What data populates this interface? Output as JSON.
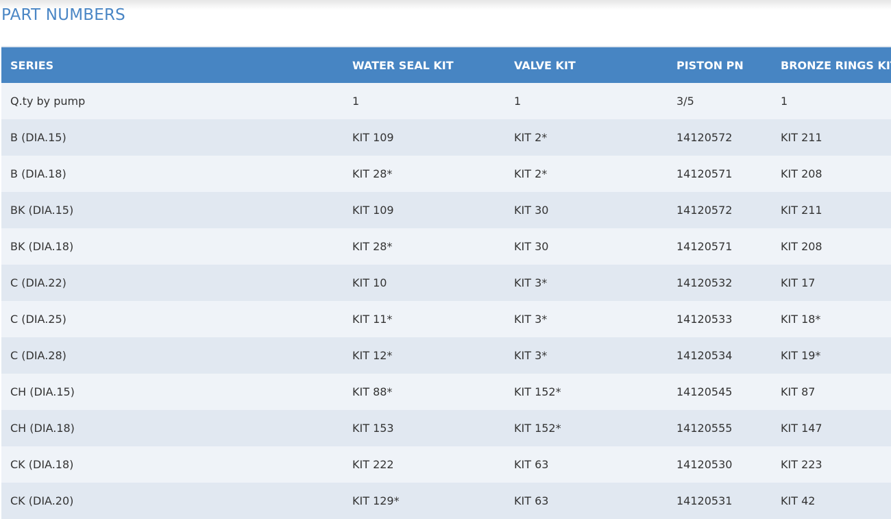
{
  "page": {
    "title": "PART NUMBERS"
  },
  "colors": {
    "title": "#4a86c5",
    "header_bg": "#4785c3",
    "row_odd": "#eff3f8",
    "row_even": "#e1e8f1"
  },
  "table": {
    "columns": [
      "SERIES",
      "WATER SEAL KIT",
      "VALVE KIT",
      "PISTON PN",
      "BRONZE RINGS KIT"
    ],
    "rows": [
      [
        "Q.ty by pump",
        "1",
        "1",
        "3/5",
        "1"
      ],
      [
        "B (DIA.15)",
        "KIT 109",
        "KIT 2*",
        "14120572",
        "KIT 211"
      ],
      [
        "B (DIA.18)",
        "KIT 28*",
        "KIT 2*",
        "14120571",
        "KIT 208"
      ],
      [
        "BK (DIA.15)",
        "KIT 109",
        "KIT 30",
        "14120572",
        "KIT 211"
      ],
      [
        "BK (DIA.18)",
        "KIT 28*",
        "KIT 30",
        "14120571",
        "KIT 208"
      ],
      [
        "C (DIA.22)",
        "KIT 10",
        "KIT 3*",
        "14120532",
        "KIT 17"
      ],
      [
        "C (DIA.25)",
        "KIT 11*",
        "KIT 3*",
        "14120533",
        "KIT 18*"
      ],
      [
        "C (DIA.28)",
        "KIT 12*",
        "KIT 3*",
        "14120534",
        "KIT 19*"
      ],
      [
        "CH (DIA.15)",
        "KIT 88*",
        "KIT 152*",
        "14120545",
        "KIT 87"
      ],
      [
        "CH (DIA.18)",
        "KIT 153",
        "KIT 152*",
        "14120555",
        "KIT 147"
      ],
      [
        "CK (DIA.18)",
        "KIT 222",
        "KIT 63",
        "14120530",
        "KIT 223"
      ],
      [
        "CK (DIA.20)",
        "KIT 129*",
        "KIT 63",
        "14120531",
        "KIT 42"
      ]
    ]
  }
}
